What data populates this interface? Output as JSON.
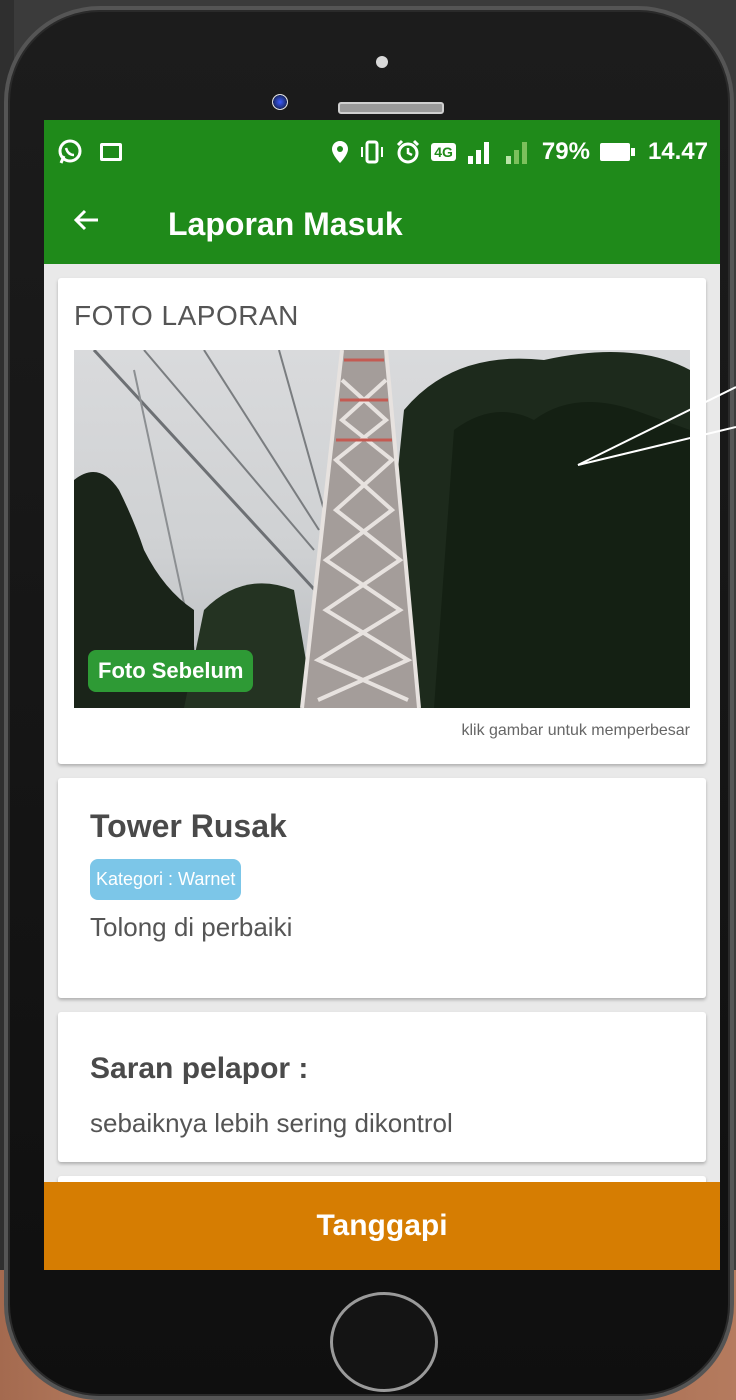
{
  "status_bar": {
    "battery": "79%",
    "time": "14.47",
    "network_label": "4G"
  },
  "app_bar": {
    "title": "Laporan Masuk"
  },
  "photo_card": {
    "section_label": "FOTO LAPORAN",
    "badge": "Foto Sebelum",
    "hint": "klik gambar untuk memperbesar"
  },
  "report": {
    "title": "Tower Rusak",
    "category": "Kategori : Warnet",
    "description": "Tolong di perbaiki"
  },
  "suggestion": {
    "title": "Saran pelapor :",
    "text": "sebaiknya lebih sering dikontrol"
  },
  "actions": {
    "respond_label": "Tanggapi"
  },
  "colors": {
    "primary": "#1f8a1a",
    "accent": "#d67d02",
    "badge_green": "#2e9a35",
    "badge_blue": "#7cc6e8"
  },
  "icons": {
    "status_left": [
      "whatsapp-icon",
      "image-icon"
    ],
    "status_right": [
      "location-icon",
      "vibrate-icon",
      "alarm-icon",
      "network-4g-icon",
      "signal-icon",
      "signal-icon",
      "battery-icon"
    ],
    "back": "arrow-left-icon"
  }
}
